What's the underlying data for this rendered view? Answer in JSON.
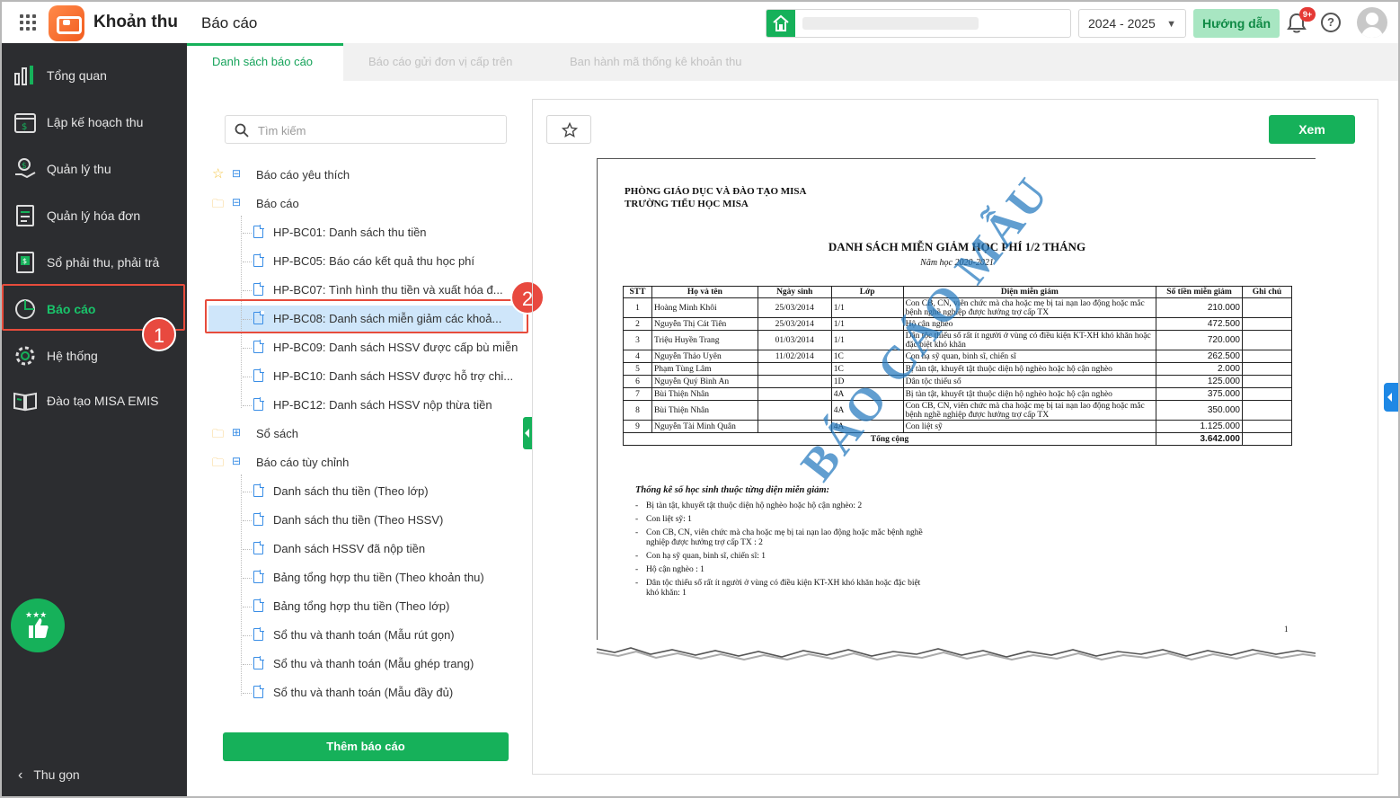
{
  "header": {
    "app_name": "Khoản thu",
    "page_title": "Báo cáo",
    "school_year": "2024 - 2025",
    "guide_label": "Hướng dẫn",
    "notification_badge": "9+"
  },
  "sidebar": {
    "items": [
      {
        "label": "Tổng quan",
        "icon": "bar-chart-icon"
      },
      {
        "label": "Lập kế hoạch thu",
        "icon": "calendar-money-icon"
      },
      {
        "label": "Quản lý thu",
        "icon": "money-hand-icon"
      },
      {
        "label": "Quản lý hóa đơn",
        "icon": "invoice-icon"
      },
      {
        "label": "Sổ phải thu, phải trả",
        "icon": "ledger-icon"
      },
      {
        "label": "Báo cáo",
        "icon": "pie-chart-icon"
      },
      {
        "label": "Hệ thống",
        "icon": "gear-icon"
      },
      {
        "label": "Đào tạo MISA EMIS",
        "icon": "book-icon"
      }
    ],
    "collapse_label": "Thu gọn",
    "marker_1": "1",
    "marker_2": "2"
  },
  "tabs": [
    {
      "label": "Danh sách báo cáo",
      "active": true
    },
    {
      "label": "Báo cáo gửi đơn vị cấp trên",
      "active": false
    },
    {
      "label": "Ban hành mã thống kê khoản thu",
      "active": false
    }
  ],
  "search": {
    "placeholder": "Tìm kiếm"
  },
  "tree": {
    "favorites": "Báo cáo yêu thích",
    "reports": "Báo cáo",
    "report_items": [
      "HP-BC01: Danh sách thu tiền",
      "HP-BC05: Báo cáo kết quả thu học phí",
      "HP-BC07: Tình hình thu tiền và xuất hóa đ...",
      "HP-BC08: Danh sách miễn giảm các khoả...",
      "HP-BC09: Danh sách HSSV được cấp bù miễn",
      "HP-BC10: Danh sách HSSV được hỗ trợ chi...",
      "HP-BC12: Danh sách HSSV nộp thừa tiền"
    ],
    "books": "Sổ sách",
    "custom": "Báo cáo tùy chỉnh",
    "custom_items": [
      "Danh sách thu tiền (Theo lớp)",
      "Danh sách thu tiền (Theo HSSV)",
      "Danh sách HSSV đã nộp tiền",
      "Bảng tổng hợp thu tiền (Theo khoản thu)",
      "Bảng tổng hợp thu tiền (Theo lớp)",
      "Sổ thu và thanh toán (Mẫu rút gọn)",
      "Sổ thu và thanh toán (Mẫu ghép trang)",
      "Sổ thu và thanh toán (Mẫu đầy đủ)"
    ],
    "add_button": "Thêm báo cáo"
  },
  "preview": {
    "view_button": "Xem",
    "org_line1": "PHÒNG GIÁO DỤC VÀ ĐÀO TẠO MISA",
    "org_line2": "TRƯỜNG TIỂU HỌC MISA",
    "title": "DANH SÁCH MIỄN GIẢM HỌC PHÍ 1/2 THÁNG",
    "subtitle": "Năm học 2020-2021",
    "columns": [
      "STT",
      "Họ và tên",
      "Ngày sinh",
      "Lớp",
      "Diện miễn giảm",
      "Số tiền miễn giảm",
      "Ghi chú"
    ],
    "rows": [
      {
        "stt": "1",
        "name": "Hoàng Minh Khôi",
        "dob": "25/03/2014",
        "cls": "1/1",
        "type": "Con CB, CN, viên chức mà cha hoặc mẹ bị tai nạn lao động hoặc mắc bệnh nghề nghiệp được hưởng trợ cấp TX",
        "amount": "210.000",
        "note": ""
      },
      {
        "stt": "2",
        "name": "Nguyễn Thị Cát Tiên",
        "dob": "25/03/2014",
        "cls": "1/1",
        "type": "Hộ cận nghèo",
        "amount": "472.500",
        "note": ""
      },
      {
        "stt": "3",
        "name": "Triệu Huyền Trang",
        "dob": "01/03/2014",
        "cls": "1/1",
        "type": "Dân tộc thiểu số rất ít người ở vùng có điều kiện KT-XH khó khăn hoặc đặc biệt khó khăn",
        "amount": "720.000",
        "note": ""
      },
      {
        "stt": "4",
        "name": "Nguyễn Thảo Uyên",
        "dob": "11/02/2014",
        "cls": "1C",
        "type": "Con hạ sỹ quan, binh sĩ, chiến sĩ",
        "amount": "262.500",
        "note": ""
      },
      {
        "stt": "5",
        "name": "Phạm Tùng Lâm",
        "dob": "",
        "cls": "1C",
        "type": "Bị tàn tật, khuyết tật thuộc diện hộ nghèo hoặc hộ cận nghèo",
        "amount": "2.000",
        "note": ""
      },
      {
        "stt": "6",
        "name": "Nguyễn Quý Bình An",
        "dob": "",
        "cls": "1D",
        "type": "Dân tộc thiểu số",
        "amount": "125.000",
        "note": ""
      },
      {
        "stt": "7",
        "name": "Bùi Thiện Nhân",
        "dob": "",
        "cls": "4A",
        "type": "Bị tàn tật, khuyết tật thuộc diện hộ nghèo hoặc hộ cận nghèo",
        "amount": "375.000",
        "note": ""
      },
      {
        "stt": "8",
        "name": "Bùi Thiện Nhân",
        "dob": "",
        "cls": "4A",
        "type": "Con CB, CN, viên chức mà cha hoặc mẹ bị tai nạn lao động hoặc mắc bệnh nghề nghiệp được hưởng trợ cấp TX",
        "amount": "350.000",
        "note": ""
      },
      {
        "stt": "9",
        "name": "Nguyễn Tài Minh Quân",
        "dob": "",
        "cls": "4A",
        "type": "Con liệt sỹ",
        "amount": "1.125.000",
        "note": ""
      }
    ],
    "total_label": "Tổng cộng",
    "total_value": "3.642.000",
    "stat_title": "Thống kê số học sinh thuộc từng diện miễn giảm:",
    "stats": [
      "Bị tàn tật, khuyết tật thuộc diện hộ nghèo hoặc hộ cận nghèo: 2",
      "Con liệt sỹ: 1",
      "Con CB, CN, viên chức mà cha hoặc mẹ bị tai nạn lao động hoặc mắc bệnh nghề nghiệp được hưởng trợ cấp TX : 2",
      "Con hạ sỹ quan, binh sĩ, chiến sĩ: 1",
      "Hộ cận nghèo : 1",
      "Dân tộc thiểu số rất ít người ở vùng có điều kiện KT-XH khó khăn hoặc đặc biệt khó khăn: 1"
    ],
    "page_number": "1",
    "watermark": "BÁO CÁO MẪU"
  },
  "colors": {
    "accent": "#16b15a",
    "sidebar_bg": "#2c2d30",
    "highlight": "#e74c3c",
    "selection": "#cfe6fa"
  }
}
